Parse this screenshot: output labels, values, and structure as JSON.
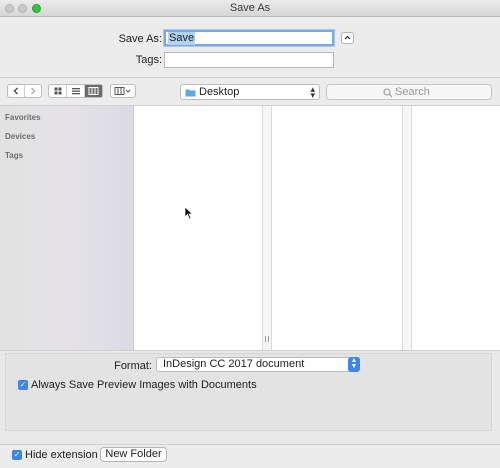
{
  "window": {
    "title": "Save As"
  },
  "save": {
    "save_as_label": "Save As:",
    "save_as_value": "Save",
    "tags_label": "Tags:",
    "tags_value": ""
  },
  "toolbar": {
    "location": "Desktop",
    "search_placeholder": "Search"
  },
  "sidebar": {
    "sections": [
      {
        "label": "Favorites"
      },
      {
        "label": "Devices"
      },
      {
        "label": "Tags"
      }
    ]
  },
  "options": {
    "format_label": "Format:",
    "format_value": "InDesign CC 2017 document",
    "preview_checkbox_label": "Always Save Preview Images with Documents",
    "preview_checked": true
  },
  "bottom": {
    "hide_extension_label": "Hide extension",
    "hide_extension_checked": true,
    "new_folder_label": "New Folder"
  },
  "colors": {
    "accent": "#3b86f0",
    "selection": "#b3d1f5",
    "zoom_button": "#2fc33f"
  },
  "icons": [
    "close-icon",
    "minimize-icon",
    "zoom-icon",
    "chevron-up-icon",
    "back-icon",
    "forward-icon",
    "icon-view-icon",
    "list-view-icon",
    "column-view-icon",
    "gallery-view-icon",
    "folder-icon",
    "search-icon",
    "mouse-pointer-icon",
    "checkmark-icon"
  ]
}
